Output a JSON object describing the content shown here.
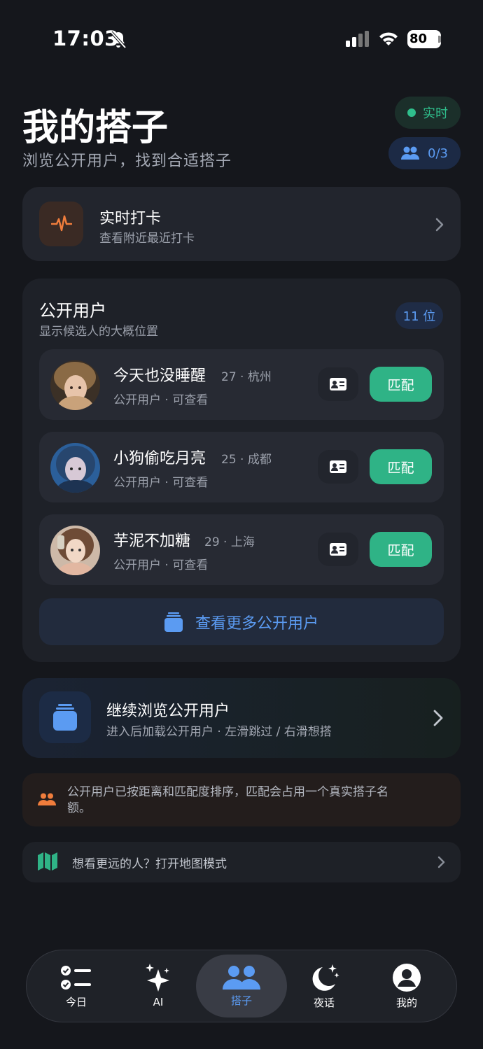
{
  "status_bar": {
    "time": "17:03",
    "battery": "80"
  },
  "header": {
    "title": "我的搭子",
    "subtitle": "浏览公开用户，找到合适搭子",
    "live_label": "实时",
    "quota": "0/3"
  },
  "checkin": {
    "title": "实时打卡",
    "subtitle": "查看附近最近打卡"
  },
  "public_users": {
    "title": "公开用户",
    "subtitle": "显示候选人的大概位置",
    "count": "11 位",
    "users": [
      {
        "name": "今天也没睡醒",
        "meta": "27 · 杭州",
        "status": "公开用户 · 可查看",
        "match_label": "匹配"
      },
      {
        "name": "小狗偷吃月亮",
        "meta": "25 · 成都",
        "status": "公开用户 · 可查看",
        "match_label": "匹配"
      },
      {
        "name": "芋泥不加糖",
        "meta": "29 · 上海",
        "status": "公开用户 · 可查看",
        "match_label": "匹配"
      }
    ],
    "more_label": "查看更多公开用户"
  },
  "browse": {
    "title": "继续浏览公开用户",
    "subtitle": "进入后加载公开用户 · 左滑跳过 / 右滑想搭"
  },
  "notice": {
    "text": "公开用户已按距离和匹配度排序，匹配会占用一个真实搭子名额。"
  },
  "map": {
    "text": "想看更远的人？打开地图模式"
  },
  "tabs": [
    {
      "label": "今日",
      "icon": "checklist-icon"
    },
    {
      "label": "AI",
      "icon": "sparkles-icon"
    },
    {
      "label": "搭子",
      "icon": "people-icon",
      "active": true
    },
    {
      "label": "夜话",
      "icon": "moon-stars-icon"
    },
    {
      "label": "我的",
      "icon": "profile-icon"
    }
  ],
  "colors": {
    "accent_green": "#2fb386",
    "accent_blue": "#5b9bf2",
    "accent_orange": "#f07d3c",
    "background": "#15171c"
  }
}
